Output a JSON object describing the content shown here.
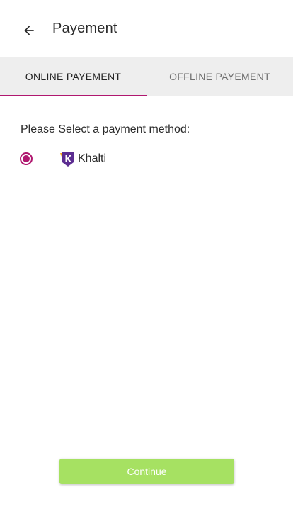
{
  "header": {
    "title": "Payement",
    "back_icon": "arrow-left-icon"
  },
  "tabs": [
    {
      "label": "ONLINE PAYEMENT",
      "active": true
    },
    {
      "label": "OFFLINE PAYEMENT",
      "active": false
    }
  ],
  "content": {
    "prompt": "Please Select a payment method:",
    "methods": [
      {
        "label": "Khalti",
        "icon": "khalti-logo-icon",
        "selected": true
      }
    ]
  },
  "footer": {
    "continue_label": "Continue"
  },
  "colors": {
    "accent": "#b0176f",
    "button": "#a6e162",
    "tabs_bg": "#eeeeee",
    "khalti_purple": "#5c2d91"
  }
}
